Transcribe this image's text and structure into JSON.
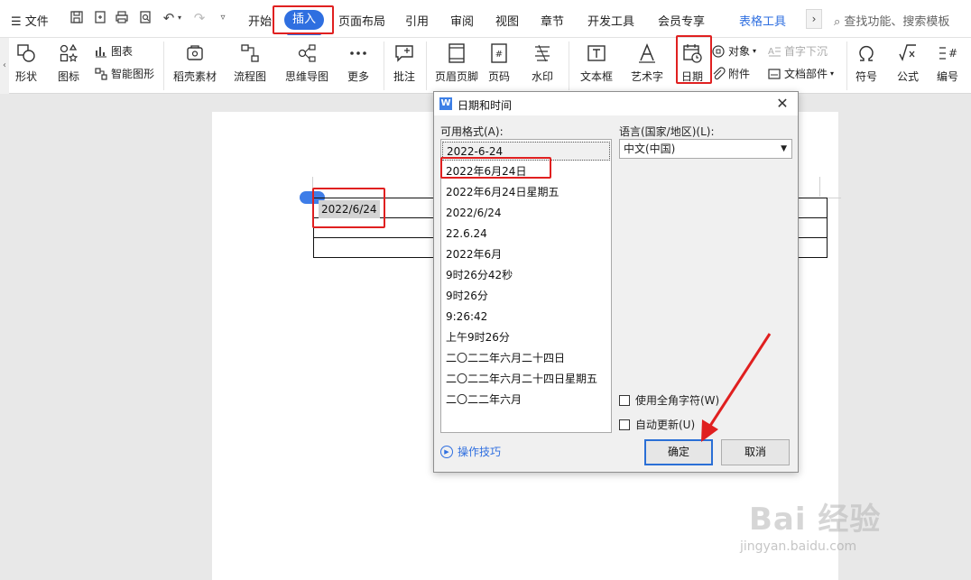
{
  "menubar": {
    "file_label": "文件",
    "tabs": [
      "开始",
      "插入",
      "页面布局",
      "引用",
      "审阅",
      "视图",
      "章节",
      "开发工具",
      "会员专享"
    ],
    "active_tab": "插入",
    "context_tab": "表格工具",
    "search_placeholder": "查找功能、搜索模板"
  },
  "ribbon": {
    "shape": "形状",
    "icon": "图标",
    "chart": "图表",
    "smart_shape": "智能图形",
    "docer": "稻壳素材",
    "flowchart": "流程图",
    "mindmap": "思维导图",
    "more": "更多",
    "comment": "批注",
    "header_footer": "页眉页脚",
    "page_number": "页码",
    "watermark": "水印",
    "textbox": "文本框",
    "wordart": "艺术字",
    "date": "日期",
    "object": "对象",
    "dropcap": "首字下沉",
    "attachment": "附件",
    "doc_part": "文档部件",
    "symbol": "符号",
    "formula": "公式",
    "numbering": "编号"
  },
  "document": {
    "cell_text": "2022/6/24"
  },
  "dialog": {
    "title": "日期和时间",
    "formats_label": "可用格式(A):",
    "formats": [
      "2022-6-24",
      "2022年6月24日",
      "2022年6月24日星期五",
      "2022/6/24",
      "22.6.24",
      "2022年6月",
      "9时26分42秒",
      "9时26分",
      "9:26:42",
      "上午9时26分",
      "二〇二二年六月二十四日",
      "二〇二二年六月二十四日星期五",
      "二〇二二年六月"
    ],
    "selected_format": "2022-6-24",
    "language_label": "语言(国家/地区)(L):",
    "language_value": "中文(中国)",
    "fullwidth_label": "使用全角字符(W)",
    "auto_update_label": "自动更新(U)",
    "tips_label": "操作技巧",
    "ok_label": "确定",
    "cancel_label": "取消"
  },
  "watermark": {
    "brand": "Bai 经验",
    "url": "jingyan.baidu.com"
  },
  "colors": {
    "accent": "#2f6fe0",
    "highlight": "#e02020"
  }
}
